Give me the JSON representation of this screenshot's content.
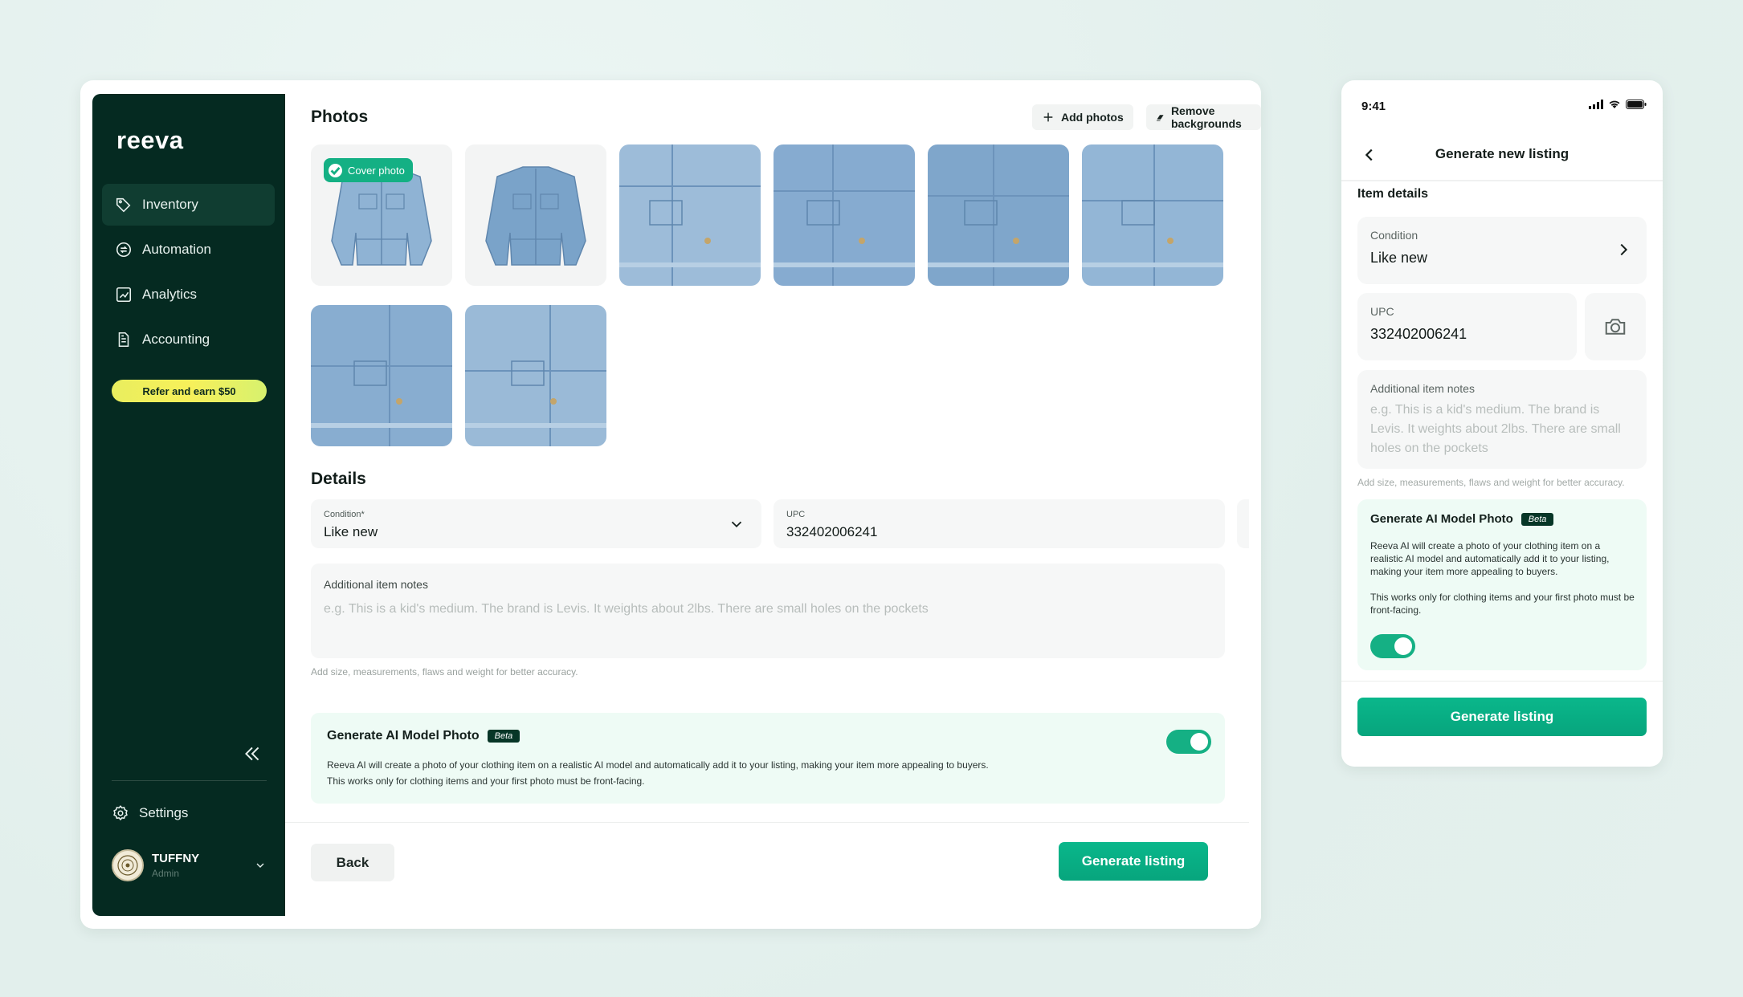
{
  "brand": {
    "name": "reeva",
    "accent": "#0ab78b",
    "sidebar_bg": "#052a21"
  },
  "sidebar": {
    "items": [
      {
        "label": "Inventory",
        "icon": "tag-icon",
        "active": true
      },
      {
        "label": "Automation",
        "icon": "automation-icon"
      },
      {
        "label": "Analytics",
        "icon": "analytics-icon"
      },
      {
        "label": "Accounting",
        "icon": "document-icon"
      }
    ],
    "refer_label": "Refer and earn $50",
    "settings_label": "Settings",
    "user": {
      "name": "TUFFNY",
      "role": "Admin"
    }
  },
  "photos": {
    "title": "Photos",
    "add_label": "Add photos",
    "remove_bg_label": "Remove backgrounds",
    "cover_label": "Cover photo",
    "count": 8
  },
  "details": {
    "title": "Details",
    "condition_label": "Condition*",
    "condition_value": "Like new",
    "upc_label": "UPC",
    "upc_value": "332402006241",
    "notes_label": "Additional item notes",
    "notes_placeholder": "e.g. This is a kid's medium. The brand is Levis. It weights about 2lbs. There are small holes on the pockets",
    "hint": "Add size, measurements, flaws and weight for better accuracy."
  },
  "ai": {
    "title": "Generate AI Model Photo",
    "badge": "Beta",
    "desc1": "Reeva AI will create a photo of your clothing item on a realistic AI model and automatically add it to your listing, making your item more appealing to buyers.",
    "desc2": "This works only for clothing items and your first photo must be front-facing.",
    "enabled": true
  },
  "actions": {
    "back_label": "Back",
    "generate_label": "Generate listing"
  },
  "mobile": {
    "time": "9:41",
    "title": "Generate new listing",
    "section": "Item details",
    "condition_label": "Condition",
    "condition_value": "Like new",
    "upc_label": "UPC",
    "upc_value": "332402006241",
    "notes_label": "Additional item notes",
    "notes_placeholder": "e.g. This is a kid's medium. The brand is Levis. It weights about 2lbs. There are small holes on the pockets",
    "hint": "Add size, measurements, flaws and weight for better accuracy.",
    "ai_title": "Generate AI Model Photo",
    "ai_badge": "Beta",
    "ai_desc1": "Reeva AI will create a photo of your clothing item on a realistic AI model and automatically add it to your listing, making your item more appealing to buyers.",
    "ai_desc2": "This works only for clothing items and your first photo must be front-facing.",
    "generate_label": "Generate listing"
  }
}
